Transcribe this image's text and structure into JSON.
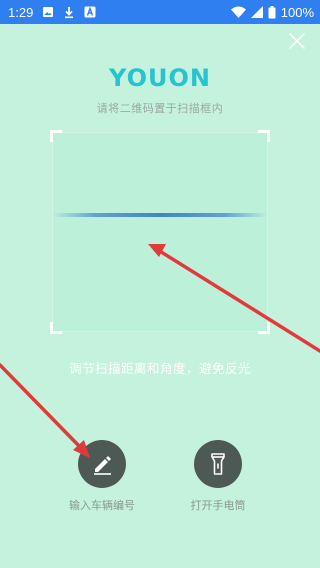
{
  "status_bar": {
    "time": "1:29",
    "battery": "100%",
    "icons": [
      "image-icon",
      "download-icon",
      "a-icon",
      "wifi-icon",
      "signal-icon",
      "battery-icon"
    ]
  },
  "header": {
    "close_icon": "close-icon",
    "logo": "YOUON",
    "hint": "请将二维码置于扫描框内"
  },
  "scanner": {
    "tip": "调节扫描距离和角度，避免反光"
  },
  "actions": [
    {
      "icon": "pencil-icon",
      "label": "输入车辆编号"
    },
    {
      "icon": "flashlight-icon",
      "label": "打开手电筒"
    }
  ],
  "colors": {
    "background": "#c4f2dd",
    "status_bar": "#2f7ff0",
    "logo": "#27c4d0",
    "button": "#4d5955",
    "annotation_arrow": "#e03a3a"
  }
}
